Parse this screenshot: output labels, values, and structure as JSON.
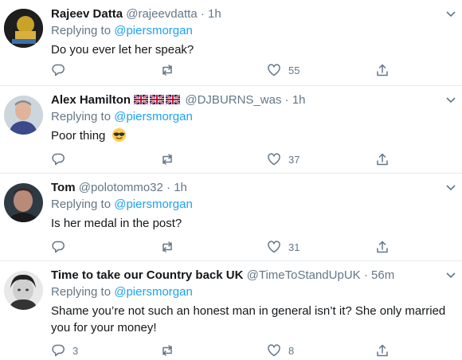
{
  "colors": {
    "accent": "#1da1f2",
    "muted": "#657786",
    "text": "#14171a",
    "border": "#e6ecf0"
  },
  "replying_label": "Replying to",
  "tweets": [
    {
      "display_name": "Rajeev Datta",
      "handle": "@rajeevdatta",
      "separator": "·",
      "time": "1h",
      "reply_to": "@piersmorgan",
      "text": "Do you ever let her speak?",
      "reply_count": "",
      "retweet_count": "",
      "like_count": "55",
      "avatar_icon": "avatar-photo"
    },
    {
      "display_name": "Alex Hamilton",
      "name_emoji": "uk-flag-icon x3",
      "handle": "@DJBURNS_was",
      "separator": "·",
      "time": "1h",
      "reply_to": "@piersmorgan",
      "text": "Poor thing",
      "text_emoji": "sunglasses-emoji-icon",
      "reply_count": "",
      "retweet_count": "",
      "like_count": "37",
      "avatar_icon": "avatar-photo"
    },
    {
      "display_name": "Tom",
      "handle": "@polotommo32",
      "separator": "·",
      "time": "1h",
      "reply_to": "@piersmorgan",
      "text": "Is her medal in the post?",
      "reply_count": "",
      "retweet_count": "",
      "like_count": "31",
      "avatar_icon": "avatar-photo"
    },
    {
      "display_name": "Time to take our Country back UK",
      "handle": "@TimeToStandUpUK",
      "separator": "·",
      "time": "56m",
      "reply_to": "@piersmorgan",
      "text": "Shame you’re not such an honest man in general isn’t it? She only married you for your money!",
      "reply_count": "3",
      "retweet_count": "",
      "like_count": "8",
      "avatar_icon": "avatar-photo"
    }
  ]
}
